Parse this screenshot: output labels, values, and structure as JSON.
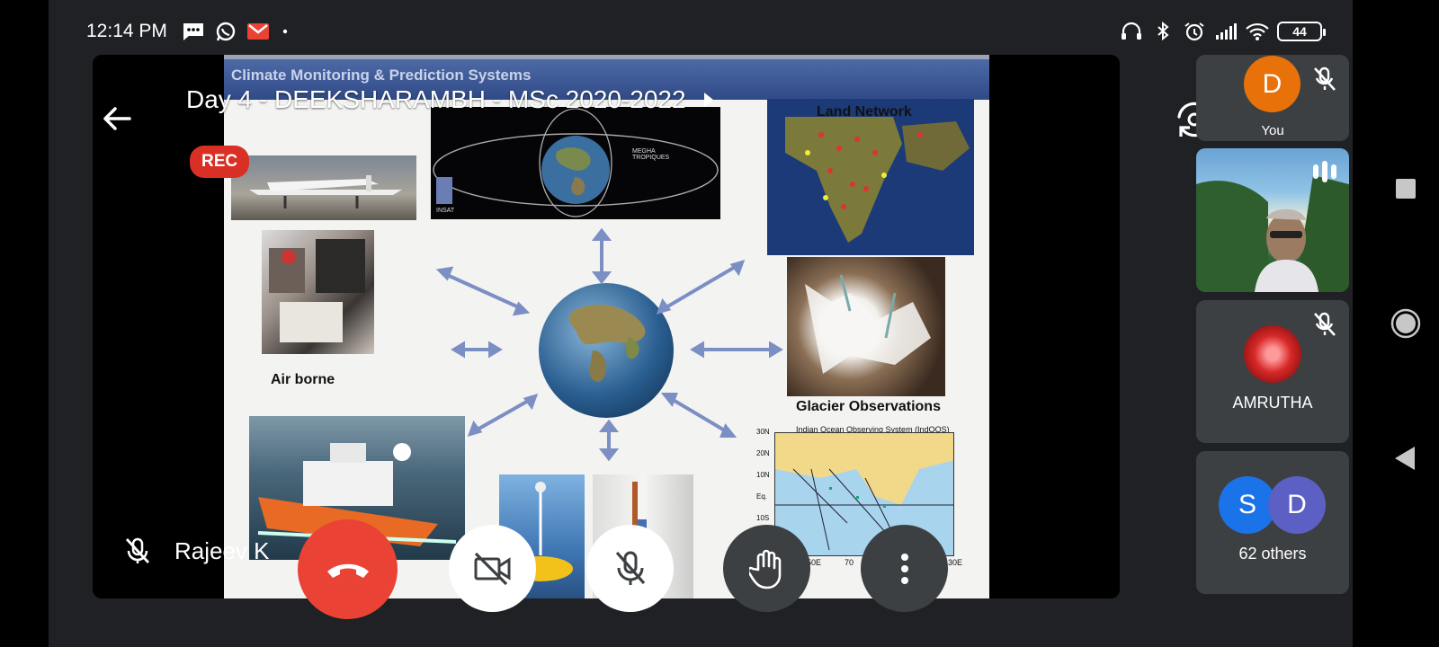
{
  "status": {
    "time": "12:14 PM",
    "battery": "44",
    "left_icons": [
      "sms-icon",
      "whatsapp-icon",
      "gmail-icon",
      "dot-icon"
    ],
    "right_icons": [
      "headset-icon",
      "bluetooth-icon",
      "alarm-icon",
      "signal-icon",
      "wifi-icon"
    ]
  },
  "meeting": {
    "title": "Day 4 - DEEKSHARAMBH - MSc 2020-2022",
    "rec_label": "REC",
    "presenter_name": "Rajeev K"
  },
  "slide": {
    "title": "Climate Monitoring & Prediction Systems",
    "labels": {
      "land_network": "Land Network",
      "air_borne": "Air borne",
      "glacier": "Glacier Observations",
      "indoos": "Indian Ocean Observing System (IndOOS)",
      "megha": "MEGHA TROPIQUES",
      "insat": "INSAT"
    },
    "map_lat_labels": [
      "30N",
      "20N",
      "10N",
      "Eq.",
      "10S"
    ],
    "map_lon_labels": [
      "50E",
      "70",
      "130E"
    ]
  },
  "participants": {
    "you": {
      "initial": "D",
      "label": "You",
      "color": "#e8710a"
    },
    "amrutha": {
      "name": "AMRUTHA"
    },
    "others": {
      "initials": [
        "S",
        "D"
      ],
      "colors": [
        "#1a73e8",
        "#5c5fc4"
      ],
      "label": "62 others"
    }
  },
  "colors": {
    "end_call": "#ea4335",
    "rec": "#d93025",
    "panel": "#3c4043",
    "background": "#202124"
  }
}
